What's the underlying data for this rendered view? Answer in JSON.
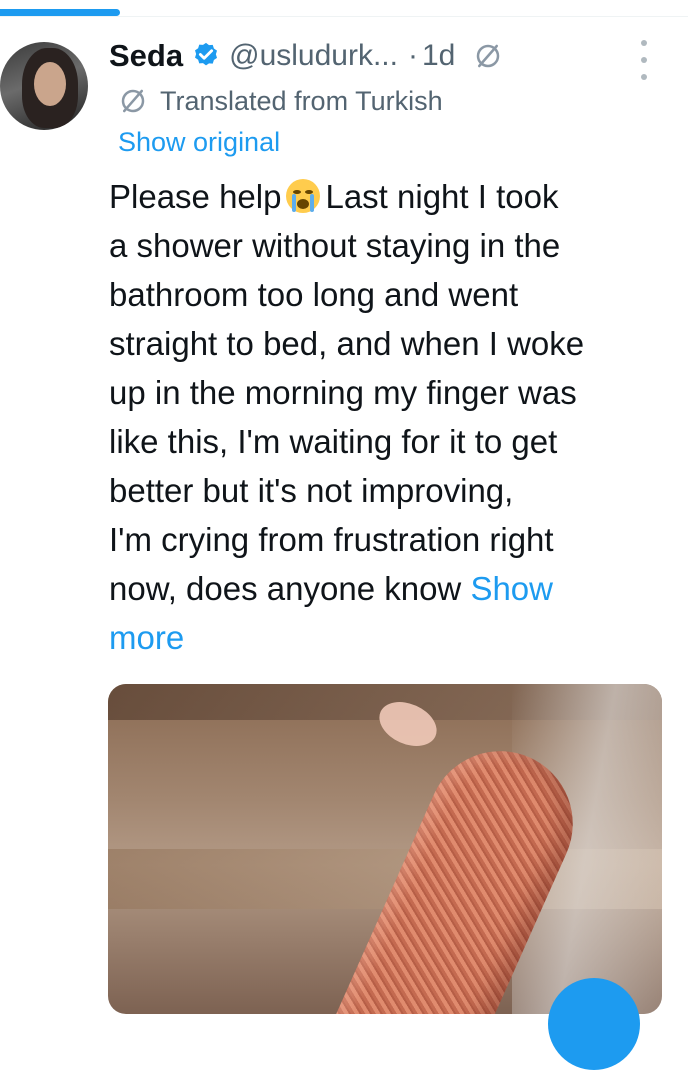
{
  "progress": {
    "fraction": 0.175,
    "color": "#1d9bf0"
  },
  "tweet": {
    "author_name": "Seda",
    "handle": "@usludurk...",
    "separator": "·",
    "time": "1d",
    "translated_label": "Translated from Turkish",
    "show_original": "Show original",
    "text_lines": [
      "Please help",
      "Last night I took",
      "a shower without staying in the",
      "bathroom too long and went",
      "straight to bed, and when I woke",
      "up in the morning my finger was",
      "like this, I'm waiting for it to get",
      "better but it's not improving,",
      "I'm crying from frustration right",
      "now, does anyone know"
    ],
    "show_more": "Show",
    "show_more_line2": "more",
    "emoji": "loudly-crying-face"
  },
  "icons": {
    "verified": "verified-badge-icon",
    "translate": "translate-icon",
    "more": "more-options-icon"
  },
  "colors": {
    "link": "#1d9bf0",
    "secondary": "#536471",
    "text": "#0f1419"
  }
}
